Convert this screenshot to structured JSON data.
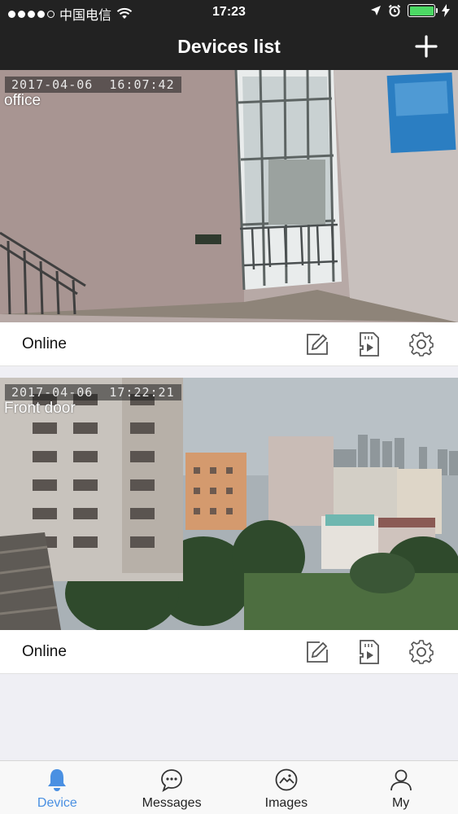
{
  "status_bar": {
    "carrier": "中国电信",
    "time": "17:23"
  },
  "header": {
    "title": "Devices list",
    "add_icon": "plus-icon"
  },
  "devices": [
    {
      "osd": "2017-04-06  16:07:42",
      "name": "office",
      "status": "Online",
      "actions": [
        "edit-icon",
        "sd-card-play-icon",
        "gear-icon"
      ]
    },
    {
      "osd": "2017-04-06  17:22:21",
      "name": "Front door",
      "status": "Online",
      "actions": [
        "edit-icon",
        "sd-card-play-icon",
        "gear-icon"
      ]
    }
  ],
  "tabs": [
    {
      "label": "Device",
      "icon": "bell-icon",
      "active": true
    },
    {
      "label": "Messages",
      "icon": "chat-bubble-icon",
      "active": false
    },
    {
      "label": "Images",
      "icon": "image-icon",
      "active": false
    },
    {
      "label": "My",
      "icon": "person-icon",
      "active": false
    }
  ],
  "colors": {
    "bar_bg": "#222222",
    "accent": "#4a90e2",
    "battery": "#4cd964"
  }
}
